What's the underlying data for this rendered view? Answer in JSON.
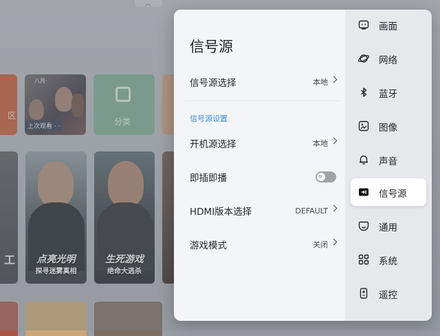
{
  "background": {
    "tiles": {
      "edge_label": "区",
      "recent_mini": "八月·",
      "recent_caption": "上次观看 · ·",
      "category_label": "分类"
    },
    "posters": {
      "edge_label": "工",
      "poster1_title": "点亮光明",
      "poster1_sub": "探寻迷雾真相",
      "poster2_title": "生死游戏",
      "poster2_sub": "绝命大逃杀"
    }
  },
  "settings_panel": {
    "title": "信号源",
    "rows": [
      {
        "label": "信号源选择",
        "value": "本地"
      },
      {
        "label": "开机源选择",
        "value": "本地"
      },
      {
        "label": "即插即播"
      },
      {
        "label": "HDMI版本选择",
        "value": "DEFAULT"
      },
      {
        "label": "游戏模式",
        "value": "关闭"
      }
    ],
    "section_label": "信号源设置",
    "toggle_state": "off"
  },
  "nav": {
    "items": [
      {
        "label": "画面",
        "icon": "picture-icon"
      },
      {
        "label": "网络",
        "icon": "network-icon"
      },
      {
        "label": "蓝牙",
        "icon": "bluetooth-icon"
      },
      {
        "label": "图像",
        "icon": "image-icon"
      },
      {
        "label": "声音",
        "icon": "sound-icon"
      },
      {
        "label": "信号源",
        "icon": "signal-source-icon"
      },
      {
        "label": "通用",
        "icon": "general-icon"
      },
      {
        "label": "系统",
        "icon": "system-icon"
      },
      {
        "label": "遥控",
        "icon": "remote-icon"
      }
    ],
    "active_index": 5
  },
  "colors": {
    "accent": "#3a8fdc",
    "panel_bg": "#f4f5f7",
    "nav_bg": "#e6e8ec"
  }
}
